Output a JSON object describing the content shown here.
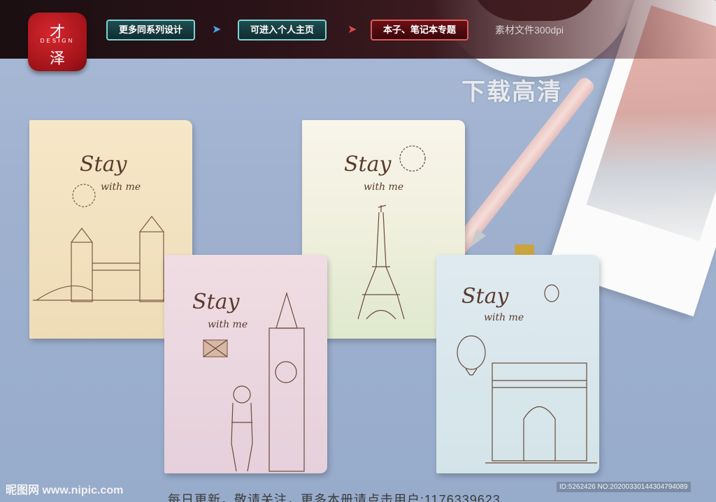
{
  "header": {
    "logo": {
      "char_top": "才",
      "brand": "DESIGN",
      "char_bottom": "泽"
    },
    "nav": [
      {
        "label": "更多同系列设计"
      },
      {
        "label": "可进入个人主页"
      },
      {
        "label": "本子、笔记本专题"
      }
    ],
    "file_note": "素材文件300dpi",
    "download_label": "下载高清"
  },
  "notebooks": [
    {
      "title": "Stay",
      "subtitle": "with me",
      "theme": "london-tower-bridge"
    },
    {
      "title": "Stay",
      "subtitle": "with me",
      "theme": "paris-eiffel-tower"
    },
    {
      "title": "Stay",
      "subtitle": "with me",
      "theme": "london-big-ben"
    },
    {
      "title": "Stay",
      "subtitle": "with me",
      "theme": "paris-arc-de-triomphe"
    }
  ],
  "footer": {
    "site": "昵图网 www.nipic.com",
    "id_line": "ID:5262426 NO:20200330144304794089",
    "bottom_text": "每日更新，敬请关注，更多本册请点击用户:1176339623"
  },
  "colors": {
    "brand_red": "#c0141b",
    "nav_teal": "#7fd3d3",
    "nav_red": "#e05a5a",
    "background": "#9fb2cf"
  }
}
